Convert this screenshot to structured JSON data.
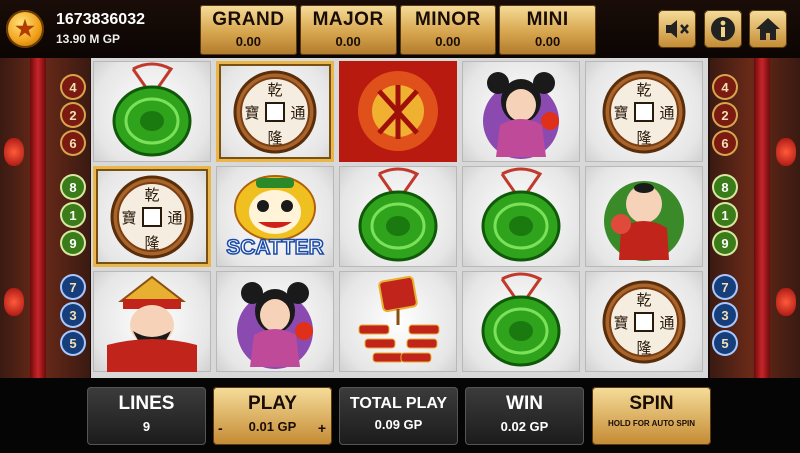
{
  "player": {
    "balance": "1673836032",
    "gp": "13.90 M GP"
  },
  "jackpots": [
    {
      "title": "GRAND",
      "value": "0.00"
    },
    {
      "title": "MAJOR",
      "value": "0.00"
    },
    {
      "title": "MINOR",
      "value": "0.00"
    },
    {
      "title": "MINI",
      "value": "0.00"
    }
  ],
  "top_buttons": {
    "mute": "mute-icon",
    "info": "info-icon",
    "home": "home-icon"
  },
  "lines_left": [
    "4",
    "2",
    "6",
    "8",
    "1",
    "9",
    "7",
    "3",
    "5"
  ],
  "lines_right": [
    "4",
    "2",
    "6",
    "8",
    "1",
    "9",
    "7",
    "3",
    "5"
  ],
  "reels": [
    [
      "jade",
      "coin",
      "red-fortune",
      "girl",
      "coin"
    ],
    [
      "coin",
      "lion-scatter",
      "jade",
      "jade",
      "boy"
    ],
    [
      "god-of-wealth",
      "girl",
      "firecrackers",
      "jade",
      "coin"
    ]
  ],
  "scatter_label": "SCATTER",
  "coin_chars": [
    "乾",
    "通",
    "隆",
    "寶"
  ],
  "bottom": {
    "lines_label": "LINES",
    "lines_value": "9",
    "play_label": "PLAY",
    "play_value": "0.01 GP",
    "play_minus": "-",
    "play_plus": "+",
    "total_label": "TOTAL PLAY",
    "total_value": "0.09 GP",
    "win_label": "WIN",
    "win_value": "0.02 GP",
    "spin_label": "SPIN",
    "spin_hint": "HOLD FOR AUTO SPIN"
  },
  "colors": {
    "gold": "#d7a54e",
    "jade": "#2fa31c",
    "bronze": "#a8642a",
    "reel_bg": "#ffffff"
  }
}
